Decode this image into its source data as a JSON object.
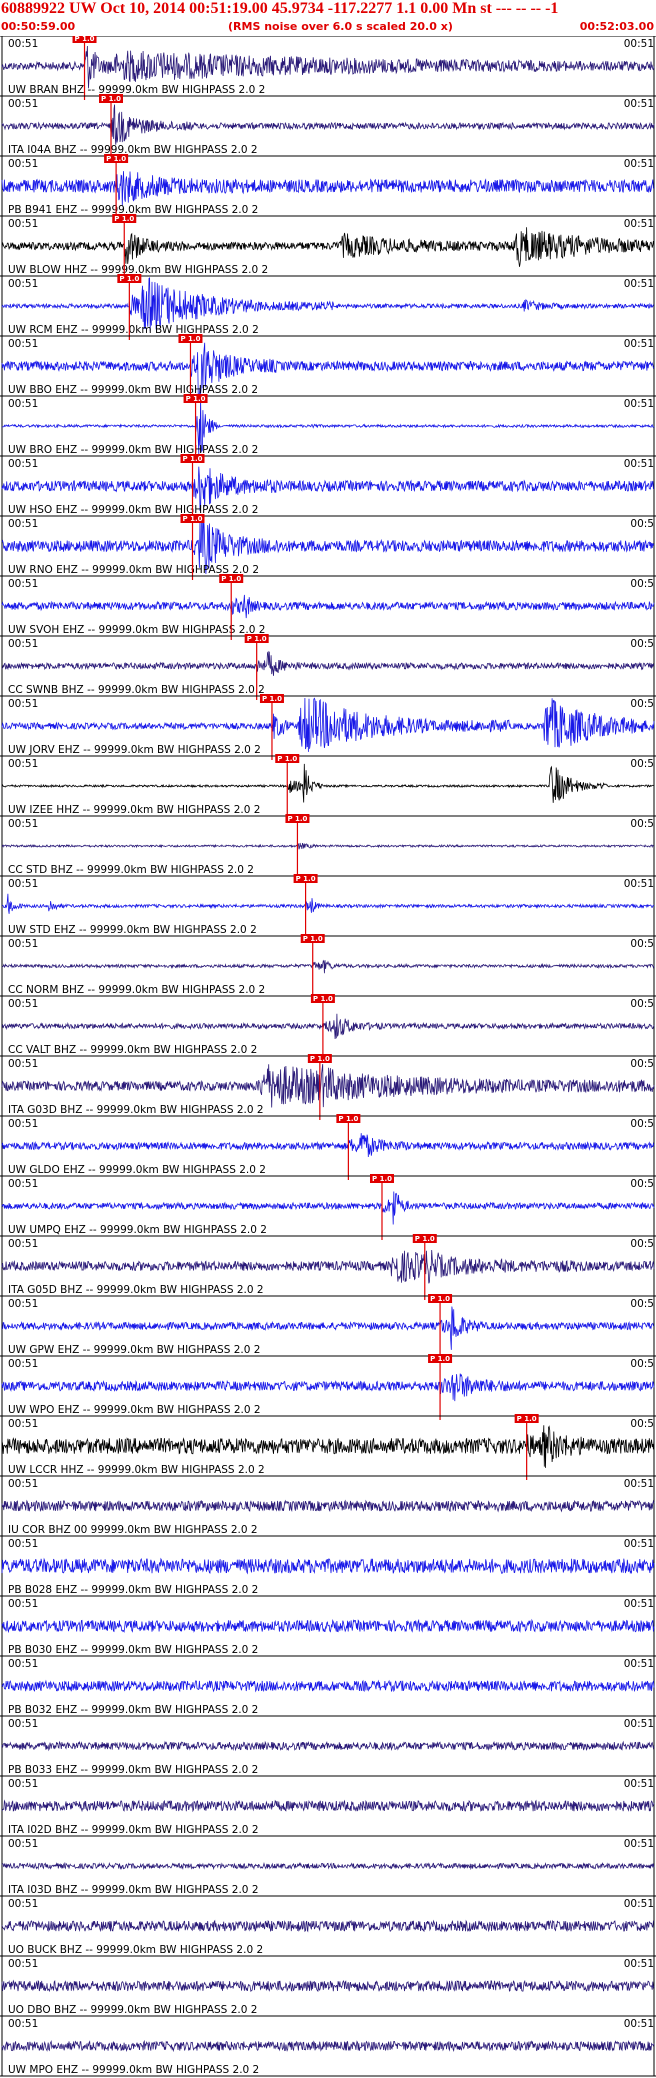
{
  "header": {
    "title": "60889922 UW Oct 10, 2014 00:51:19.00   45.9734 -117.2277  1.1 0.00 Mn st --- -- --  -1",
    "start_time": "00:50:59.00",
    "rms_note": "(RMS noise over 6.0 s scaled 20.0 x)",
    "end_time": "00:52:03.00"
  },
  "colors": {
    "title": "#e00000",
    "pick": "#e00000",
    "trace_blue": "#1818e8",
    "trace_navy": "#2a1a78",
    "trace_black": "#000000"
  },
  "chart_data": {
    "type": "line",
    "x_unit": "time",
    "x_start": "00:50:59.00",
    "x_end": "00:52:03.00",
    "x_range_seconds": [
      0,
      64
    ],
    "pick_label": "P 1.0",
    "tick_left": "00:51",
    "tick_right": "00:51",
    "tick_right_truncated": "00:5",
    "traces": [
      {
        "label": "UW BRAN BHZ -- 99999.0km BW  HIGHPASS  2.0  2",
        "color": "navy",
        "pick_s": 8.1,
        "amp": 0.45,
        "noise": 0.15,
        "bursts": [
          [
            8.1,
            2.0,
            0.9
          ],
          [
            10,
            45,
            0.55
          ]
        ]
      },
      {
        "label": "ITA I04A BHZ -- 99999.0km BW  HIGHPASS  2.0  2",
        "color": "navy",
        "pick_s": 10.7,
        "amp": 0.4,
        "noise": 0.12,
        "bursts": [
          [
            10.7,
            5,
            0.7
          ]
        ]
      },
      {
        "label": "PB B941 EHZ -- 99999.0km BW  HIGHPASS  2.0  2",
        "color": "blue",
        "pick_s": 11.2,
        "amp": 0.35,
        "noise": 0.25,
        "bursts": [
          [
            11.2,
            8,
            0.5
          ]
        ]
      },
      {
        "label": "UW BLOW HHZ -- 99999.0km BW  HIGHPASS  2.0  2",
        "color": "black",
        "pick_s": 12.0,
        "amp": 0.45,
        "noise": 0.15,
        "bursts": [
          [
            12.0,
            4,
            0.5
          ],
          [
            33,
            12,
            0.4
          ],
          [
            50,
            14,
            0.7
          ]
        ]
      },
      {
        "label": "UW RCM EHZ -- 99999.0km BW  HIGHPASS  2.0  2",
        "color": "blue",
        "pick_s": 12.5,
        "amp": 0.9,
        "noise": 0.08,
        "bursts": [
          [
            13.5,
            12,
            1.2
          ],
          [
            51,
            4,
            0.2
          ]
        ]
      },
      {
        "label": "UW BBO EHZ -- 99999.0km BW  HIGHPASS  2.0  2",
        "color": "blue",
        "pick_s": 18.5,
        "amp": 0.6,
        "noise": 0.18,
        "bursts": [
          [
            19.0,
            5,
            1.2
          ]
        ]
      },
      {
        "label": "UW BRO EHZ -- 99999.0km BW  HIGHPASS  2.0  2",
        "color": "blue",
        "pick_s": 19.0,
        "amp": 0.8,
        "noise": 0.05,
        "bursts": [
          [
            19.2,
            1.2,
            1.5
          ],
          [
            30.2,
            0.5,
            0.3
          ]
        ]
      },
      {
        "label": "UW HSO EHZ -- 99999.0km BW  HIGHPASS  2.0  2",
        "color": "blue",
        "pick_s": 18.7,
        "amp": 0.5,
        "noise": 0.2,
        "bursts": [
          [
            19.0,
            5,
            0.9
          ]
        ]
      },
      {
        "label": "UW RNO EHZ -- 99999.0km BW  HIGHPASS  2.0  2",
        "color": "blue",
        "pick_s": 18.7,
        "amp": 0.55,
        "noise": 0.22,
        "bursts": [
          [
            19.2,
            5,
            1.1
          ]
        ]
      },
      {
        "label": "UW SVOH EHZ -- 99999.0km BW  HIGHPASS  2.0  2",
        "color": "blue",
        "pick_s": 22.5,
        "amp": 0.4,
        "noise": 0.15,
        "bursts": [
          [
            23.7,
            1.0,
            0.6
          ]
        ]
      },
      {
        "label": "CC SWNB BHZ -- 99999.0km BW  HIGHPASS  2.0  2",
        "color": "navy",
        "pick_s": 25.0,
        "amp": 0.35,
        "noise": 0.12,
        "bursts": [
          [
            26,
            2,
            0.5
          ]
        ]
      },
      {
        "label": "UW JORV EHZ -- 99999.0km BW  HIGHPASS  2.0  2",
        "color": "blue",
        "pick_s": 26.5,
        "amp": 0.9,
        "noise": 0.12,
        "bursts": [
          [
            29,
            13,
            1.3
          ],
          [
            53,
            10,
            1.2
          ]
        ]
      },
      {
        "label": "UW IZEE HHZ -- 99999.0km BW  HIGHPASS  2.0  2",
        "color": "black",
        "pick_s": 28.0,
        "amp": 0.55,
        "noise": 0.04,
        "bursts": [
          [
            29.5,
            1.2,
            1.1
          ],
          [
            53.7,
            3.5,
            1.1
          ]
        ]
      },
      {
        "label": "CC STD BHZ -- 99999.0km BW  HIGHPASS  2.0  2",
        "color": "navy",
        "pick_s": 29.0,
        "amp": 0.2,
        "noise": 0.04,
        "bursts": []
      },
      {
        "label": "UW STD EHZ -- 99999.0km BW  HIGHPASS  2.0  2",
        "color": "blue",
        "pick_s": 29.8,
        "amp": 0.25,
        "noise": 0.06,
        "bursts": [
          [
            0.5,
            1,
            0.5
          ],
          [
            4.5,
            1,
            0.4
          ],
          [
            30.2,
            0.5,
            0.5
          ]
        ]
      },
      {
        "label": "CC NORM BHZ -- 99999.0km BW  HIGHPASS  2.0  2",
        "color": "navy",
        "pick_s": 30.5,
        "amp": 0.3,
        "noise": 0.06,
        "bursts": [
          [
            31.5,
            1.5,
            0.2
          ]
        ]
      },
      {
        "label": "CC VALT BHZ -- 99999.0km BW  HIGHPASS  2.0  2",
        "color": "navy",
        "pick_s": 31.5,
        "amp": 0.35,
        "noise": 0.1,
        "bursts": [
          [
            32.5,
            3,
            0.5
          ]
        ]
      },
      {
        "label": "ITA G03D BHZ -- 99999.0km BW  HIGHPASS  2.0  2",
        "color": "navy",
        "pick_s": 31.2,
        "amp": 0.5,
        "noise": 0.18,
        "bursts": [
          [
            25,
            25,
            0.8
          ]
        ]
      },
      {
        "label": "UW GLDO EHZ -- 99999.0km BW  HIGHPASS  2.0  2",
        "color": "blue",
        "pick_s": 34.0,
        "amp": 0.35,
        "noise": 0.14,
        "bursts": [
          [
            35,
            3,
            0.6
          ]
        ]
      },
      {
        "label": "UW UMPQ EHZ -- 99999.0km BW  HIGHPASS  2.0  2",
        "color": "blue",
        "pick_s": 37.3,
        "amp": 0.45,
        "noise": 0.12,
        "bursts": [
          [
            38.3,
            1,
            1.1
          ]
        ]
      },
      {
        "label": "ITA G05D BHZ -- 99999.0km BW  HIGHPASS  2.0  2",
        "color": "navy",
        "pick_s": 41.5,
        "amp": 0.5,
        "noise": 0.18,
        "bursts": [
          [
            38,
            12,
            0.6
          ]
        ]
      },
      {
        "label": "UW GPW EHZ -- 99999.0km BW  HIGHPASS  2.0  2",
        "color": "blue",
        "pick_s": 43.0,
        "amp": 0.45,
        "noise": 0.14,
        "bursts": [
          [
            44,
            2,
            0.9
          ]
        ]
      },
      {
        "label": "UW WPO EHZ -- 99999.0km BW  HIGHPASS  2.0  2",
        "color": "blue",
        "pick_s": 43.0,
        "amp": 0.4,
        "noise": 0.18,
        "bursts": [
          [
            44,
            4,
            0.6
          ]
        ]
      },
      {
        "label": "UW LCCR HHZ -- 99999.0km BW  HIGHPASS  2.0  2",
        "color": "black",
        "pick_s": 51.5,
        "amp": 0.4,
        "noise": 0.3,
        "bursts": [
          [
            53,
            3,
            0.8
          ]
        ]
      },
      {
        "label": "IU COR BHZ 00 99999.0km BW  HIGHPASS  2.0  2",
        "color": "navy",
        "pick_s": null,
        "amp": 0.3,
        "noise": 0.2,
        "bursts": []
      },
      {
        "label": "PB B028 EHZ -- 99999.0km BW  HIGHPASS  2.0  2",
        "color": "blue",
        "pick_s": null,
        "amp": 0.3,
        "noise": 0.28,
        "bursts": []
      },
      {
        "label": "PB B030 EHZ -- 99999.0km BW  HIGHPASS  2.0  2",
        "color": "blue",
        "pick_s": null,
        "amp": 0.3,
        "noise": 0.22,
        "bursts": []
      },
      {
        "label": "PB B032 EHZ -- 99999.0km BW  HIGHPASS  2.0  2",
        "color": "blue",
        "pick_s": null,
        "amp": 0.3,
        "noise": 0.2,
        "bursts": []
      },
      {
        "label": "PB B033 EHZ -- 99999.0km BW  HIGHPASS  2.0  2",
        "color": "navy",
        "pick_s": null,
        "amp": 0.3,
        "noise": 0.15,
        "bursts": []
      },
      {
        "label": "ITA I02D BHZ -- 99999.0km BW  HIGHPASS  2.0  2",
        "color": "navy",
        "pick_s": null,
        "amp": 0.3,
        "noise": 0.2,
        "bursts": []
      },
      {
        "label": "ITA I03D BHZ -- 99999.0km BW  HIGHPASS  2.0  2",
        "color": "navy",
        "pick_s": null,
        "amp": 0.3,
        "noise": 0.1,
        "bursts": []
      },
      {
        "label": "UO BUCK BHZ -- 99999.0km BW  HIGHPASS  2.0  2",
        "color": "navy",
        "pick_s": null,
        "amp": 0.3,
        "noise": 0.2,
        "bursts": []
      },
      {
        "label": "UO DBO BHZ -- 99999.0km BW  HIGHPASS  2.0  2",
        "color": "navy",
        "pick_s": null,
        "amp": 0.3,
        "noise": 0.2,
        "bursts": []
      },
      {
        "label": "UW MPO EHZ -- 99999.0km BW  HIGHPASS  2.0  2",
        "color": "navy",
        "pick_s": null,
        "amp": 0.3,
        "noise": 0.18,
        "bursts": []
      }
    ]
  }
}
